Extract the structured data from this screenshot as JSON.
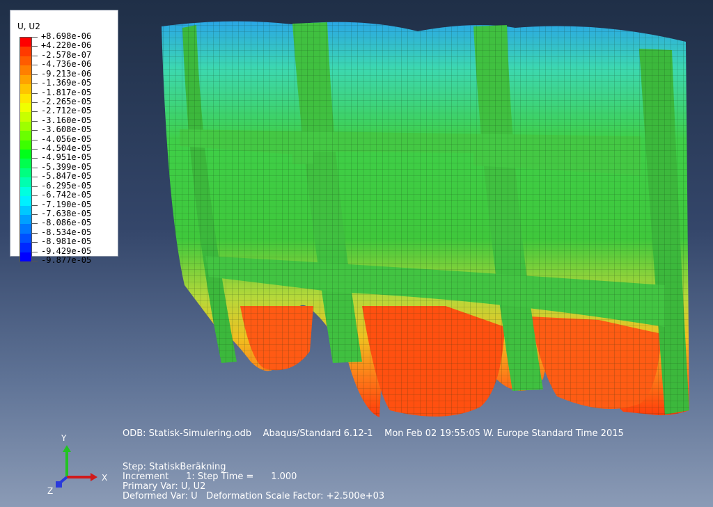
{
  "legend": {
    "title": "U, U2",
    "labels": [
      "+8.698e-06",
      "+4.220e-06",
      "-2.578e-07",
      "-4.736e-06",
      "-9.213e-06",
      "-1.369e-05",
      "-1.817e-05",
      "-2.265e-05",
      "-2.712e-05",
      "-3.160e-05",
      "-3.608e-05",
      "-4.056e-05",
      "-4.504e-05",
      "-4.951e-05",
      "-5.399e-05",
      "-5.847e-05",
      "-6.295e-05",
      "-6.742e-05",
      "-7.190e-05",
      "-7.638e-05",
      "-8.086e-05",
      "-8.534e-05",
      "-8.981e-05",
      "-9.429e-05",
      "-9.877e-05"
    ],
    "colors": [
      "#ff0000",
      "#ff3a00",
      "#ff5c00",
      "#ff7f00",
      "#ffa200",
      "#ffc400",
      "#ffe600",
      "#f0ff00",
      "#c8ff00",
      "#9eff00",
      "#6aff00",
      "#3cff00",
      "#00ff1a",
      "#00ff4e",
      "#00ff80",
      "#00ffb0",
      "#00ffe0",
      "#00f0ff",
      "#00c8ff",
      "#00a0ff",
      "#0078ff",
      "#0050ff",
      "#0028ff",
      "#0000ff"
    ]
  },
  "info": {
    "odb_line": "ODB: Statisk-Simulering.odb    Abaqus/Standard 6.12-1    Mon Feb 02 19:55:05 W. Europe Standard Time 2015",
    "step_line": "Step: StatiskBeräkning",
    "increment_line": "Increment      1: Step Time =      1.000",
    "primary_line": "Primary Var: U, U2",
    "deformed_line": "Deformed Var: U   Deformation Scale Factor: +2.500e+03"
  },
  "triad": {
    "y": "Y",
    "x": "X",
    "z": "Z"
  },
  "colors": {
    "mesh_green": "#3cc83c",
    "mesh_line": "#1a3a1a",
    "bottom_red": "#ff4a10",
    "top_blue": "#2aa0e8"
  }
}
